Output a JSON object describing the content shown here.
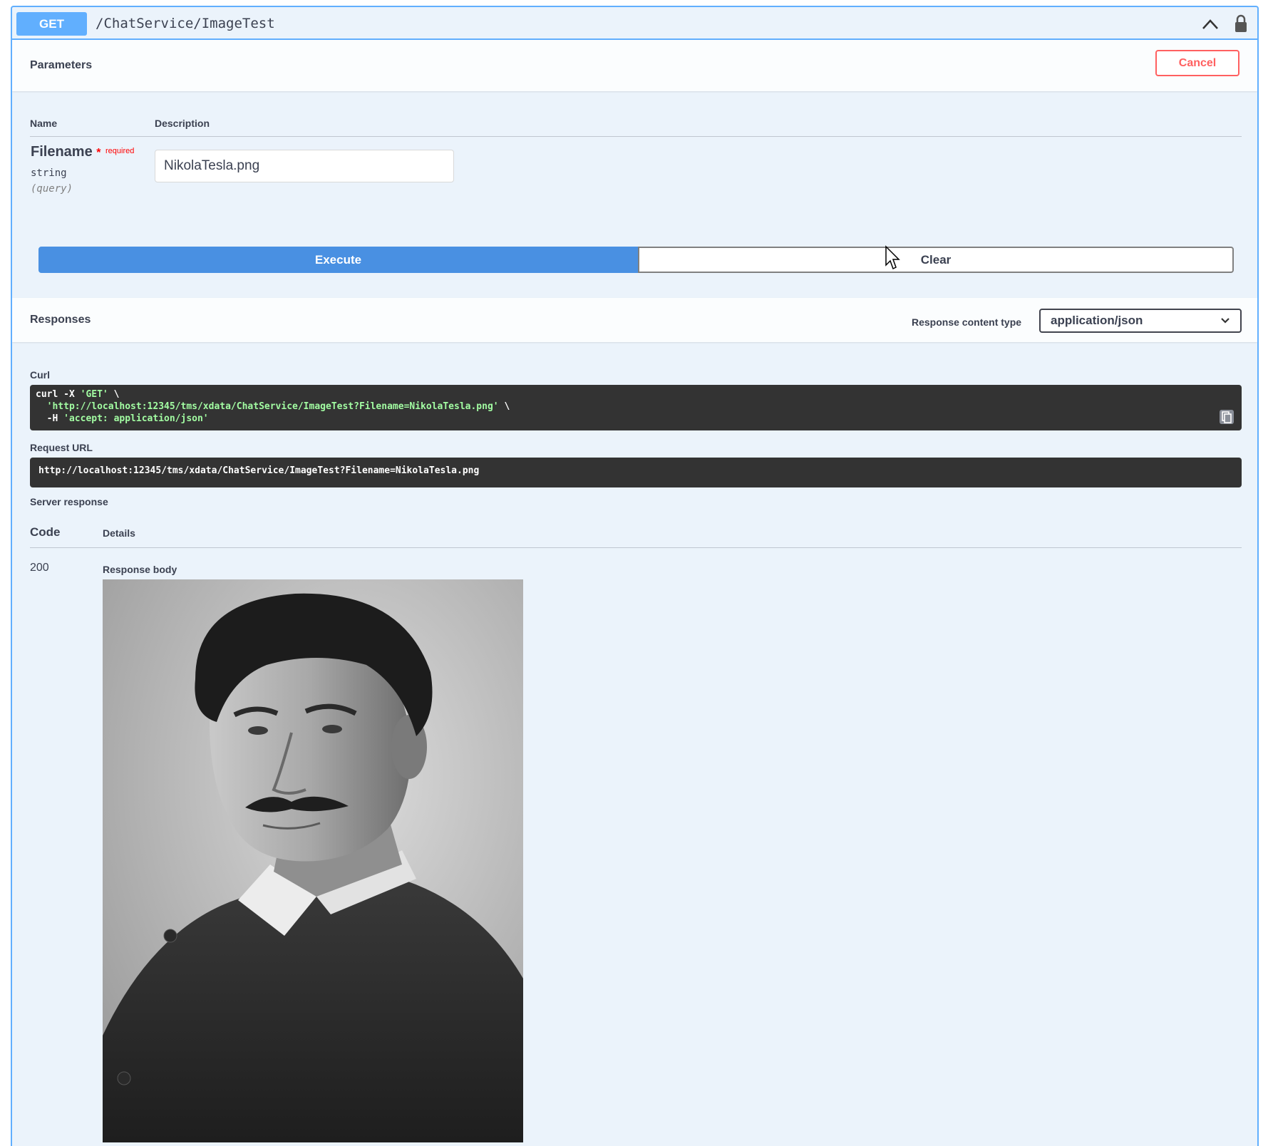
{
  "operation": {
    "method": "GET",
    "path": "/ChatService/ImageTest"
  },
  "parameters": {
    "title": "Parameters",
    "cancel_label": "Cancel",
    "col_name": "Name",
    "col_description": "Description",
    "items": [
      {
        "name": "Filename",
        "required_star": "*",
        "required_text": "required",
        "type": "string",
        "in": "(query)",
        "value": "NikolaTesla.png"
      }
    ]
  },
  "actions": {
    "execute_label": "Execute",
    "clear_label": "Clear"
  },
  "responses": {
    "title": "Responses",
    "content_type_label": "Response content type",
    "content_type_value": "application/json"
  },
  "curl": {
    "label": "Curl",
    "line1_cmd": "curl -X ",
    "line1_method": "'GET'",
    "line1_tail": " \\",
    "line2_url": "'http://localhost:12345/tms/xdata/ChatService/ImageTest?Filename=NikolaTesla.png'",
    "line2_tail": " \\",
    "line3_flag": "  -H ",
    "line3_header": "'accept: application/json'"
  },
  "request_url": {
    "label": "Request URL",
    "value": "http://localhost:12345/tms/xdata/ChatService/ImageTest?Filename=NikolaTesla.png"
  },
  "server_response": {
    "label": "Server response",
    "col_code": "Code",
    "col_details": "Details",
    "code": "200",
    "body_label": "Response body"
  },
  "colors": {
    "get_accent": "#61affe",
    "execute": "#4990e2",
    "cancel": "#ff6060",
    "code_bg": "#333333",
    "code_string": "#a2fca2"
  }
}
